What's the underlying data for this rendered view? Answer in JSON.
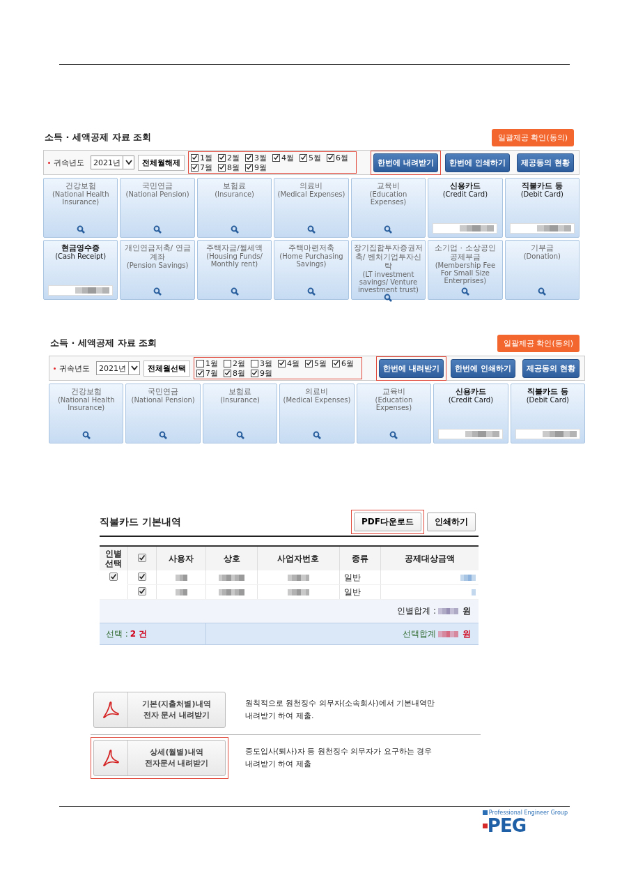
{
  "screens": [
    {
      "title": "소득 · 세액공제 자료 조회",
      "consent_button": "일괄제공 확인(동의)",
      "year_label": "귀속년도",
      "year_value": "2021년",
      "toggle_button": "전체월해제",
      "months_highlighted": true,
      "months": [
        {
          "label": "1월",
          "checked": true
        },
        {
          "label": "2월",
          "checked": true
        },
        {
          "label": "3월",
          "checked": true
        },
        {
          "label": "4월",
          "checked": true
        },
        {
          "label": "5월",
          "checked": true
        },
        {
          "label": "6월",
          "checked": true
        },
        {
          "label": "7월",
          "checked": true
        },
        {
          "label": "8월",
          "checked": true
        },
        {
          "label": "9월",
          "checked": true
        }
      ],
      "actions": [
        {
          "label": "한번에 내려받기",
          "highlighted": true
        },
        {
          "label": "한번에 인쇄하기",
          "highlighted": false
        },
        {
          "label": "제공동의 현황",
          "highlighted": false
        }
      ],
      "tiles": [
        {
          "name": "건강보험",
          "english": "(National Health Insurance)",
          "active": false,
          "kind": "search"
        },
        {
          "name": "국민연금",
          "english": "(National Pension)",
          "active": false,
          "kind": "search"
        },
        {
          "name": "보험료",
          "english": "(Insurance)",
          "active": false,
          "kind": "search"
        },
        {
          "name": "의료비",
          "english": "(Medical Expenses)",
          "active": false,
          "kind": "search"
        },
        {
          "name": "교육비",
          "english": "(Education Expenses)",
          "active": false,
          "kind": "search"
        },
        {
          "name": "신용카드",
          "english": "(Credit Card)",
          "active": true,
          "kind": "amount"
        },
        {
          "name": "직불카드 등",
          "english": "(Debit Card)",
          "active": true,
          "kind": "amount"
        },
        {
          "name": "현금영수증",
          "english": "(Cash Receipt)",
          "active": true,
          "kind": "amount"
        },
        {
          "name": "개인연금저축/ 연금계좌",
          "english": "(Pension Savings)",
          "active": false,
          "kind": "search"
        },
        {
          "name": "주택자금/월세액",
          "english": "(Housing Funds/ Monthly rent)",
          "active": false,
          "kind": "search"
        },
        {
          "name": "주택마련저축",
          "english": "(Home Purchasing Savings)",
          "active": false,
          "kind": "search"
        },
        {
          "name": "장기집합투자증권저축/ 벤처기업투자신탁",
          "english": "(LT investment savings/ Venture investment trust)",
          "active": false,
          "kind": "search"
        },
        {
          "name": "소기업 · 소상공인 공제부금",
          "english": "(Membership Fee For Small Size Enterprises)",
          "active": false,
          "kind": "search"
        },
        {
          "name": "기부금",
          "english": "(Donation)",
          "active": false,
          "kind": "search"
        }
      ]
    },
    {
      "title": "소득 · 세액공제 자료 조회",
      "consent_button": "일괄제공 확인(동의)",
      "year_label": "귀속년도",
      "year_value": "2021년",
      "toggle_button": "전체월선택",
      "months_highlighted": true,
      "months": [
        {
          "label": "1월",
          "checked": false
        },
        {
          "label": "2월",
          "checked": false
        },
        {
          "label": "3월",
          "checked": false
        },
        {
          "label": "4월",
          "checked": true
        },
        {
          "label": "5월",
          "checked": true
        },
        {
          "label": "6월",
          "checked": true
        },
        {
          "label": "7월",
          "checked": true
        },
        {
          "label": "8월",
          "checked": true
        },
        {
          "label": "9월",
          "checked": true
        }
      ],
      "actions": [
        {
          "label": "한번에 내려받기",
          "highlighted": true
        },
        {
          "label": "한번에 인쇄하기",
          "highlighted": false
        },
        {
          "label": "제공동의 현황",
          "highlighted": false
        }
      ],
      "tiles": [
        {
          "name": "건강보험",
          "english": "(National Health Insurance)",
          "active": false,
          "kind": "search"
        },
        {
          "name": "국민연금",
          "english": "(National Pension)",
          "active": false,
          "kind": "search"
        },
        {
          "name": "보험료",
          "english": "(Insurance)",
          "active": false,
          "kind": "search"
        },
        {
          "name": "의료비",
          "english": "(Medical Expenses)",
          "active": false,
          "kind": "search"
        },
        {
          "name": "교육비",
          "english": "(Education Expenses)",
          "active": false,
          "kind": "search"
        },
        {
          "name": "신용카드",
          "english": "(Credit Card)",
          "active": true,
          "kind": "amount"
        },
        {
          "name": "직불카드 등",
          "english": "(Debit Card)",
          "active": true,
          "kind": "amount"
        }
      ]
    }
  ],
  "detail": {
    "title": "직불카드 기본내역",
    "buttons": [
      {
        "label": "PDF다운로드",
        "highlighted": true
      },
      {
        "label": "인쇄하기",
        "highlighted": false
      }
    ],
    "columns": [
      "인별 선택",
      "사용자",
      "상호",
      "사업자번호",
      "종류",
      "공제대상금액"
    ],
    "select_all_checked": true,
    "person_checked": true,
    "rows": [
      {
        "checked": true,
        "type": "일반"
      },
      {
        "checked": true,
        "type": "일반"
      }
    ],
    "person_total_label": "인별합계 :",
    "person_total_unit": "원",
    "selection_label": "선택 :",
    "selection_count": "2 건",
    "selection_total_label": "선택합계",
    "selection_total_unit": "원"
  },
  "downloads": [
    {
      "title_lines": [
        "기본(지출처별)내역",
        "전자 문서 내려받기"
      ],
      "description_lines": [
        "원칙적으로 원천징수 의무자(소속회사)에서 기본내역만",
        "내려받기 하여 제출."
      ],
      "highlighted": false
    },
    {
      "title_lines": [
        "상세(월별)내역",
        "전자문서 내려받기"
      ],
      "description_lines": [
        "중도입사(퇴사)자 등 원천징수 의무자가 요구하는 경우",
        "내려받기 하여 제출"
      ],
      "highlighted": true
    }
  ],
  "logo": {
    "tagline": "Professional Engineer Group",
    "wordmark": "PEG"
  }
}
